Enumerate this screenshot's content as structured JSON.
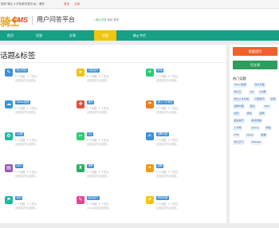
{
  "topbar": {
    "welcome": "您好 骑士人才系统问答平台！请先",
    "login": "登录",
    "register": "注册"
  },
  "header": {
    "logo_main": "骑士",
    "logo_cms": "CMS",
    "title": "用户问答平台",
    "subtitle_dot": "•",
    "subtitle_brand": "骑士问答",
    "subtitle_rest": "首页 发布"
  },
  "nav": {
    "items": [
      "首页",
      "问答",
      "文章",
      "话题",
      "骑士专栏"
    ],
    "active_index": 3
  },
  "main": {
    "title": "话题&标签",
    "cards": [
      {
        "icon": "✎",
        "color": "#3b8fd8",
        "tag": "骑士问答",
        "meta": "0 个问题 · 0 个关注",
        "desc": "话题描述信息模板..."
      },
      {
        "icon": "➤",
        "color": "#f1c40f",
        "tag": "问答技巧",
        "meta": "0 个问题 · 0 个关注",
        "desc": "话题描述信息模板..."
      },
      {
        "icon": "✈",
        "color": "#2ecc71",
        "tag": "职场",
        "meta": "0 个问题 · 0 个关注",
        "desc": "话题描述信息模板..."
      },
      {
        "icon": "☁",
        "color": "#3498db",
        "tag": "76cms官网",
        "meta": "0 个问题 · 0 个关注",
        "desc": "话题描述信息模板..."
      },
      {
        "icon": "✚",
        "color": "#e74c3c",
        "tag": "猎头",
        "meta": "0 个问题 · 0 个关注",
        "desc": "话题描述信息模板..."
      },
      {
        "icon": "☂",
        "color": "#e67e22",
        "tag": "骑士人才系统",
        "meta": "0 个问题 · 0 个关注",
        "desc": "话题描述信息模板..."
      },
      {
        "icon": "❂",
        "color": "#1abc9c",
        "tag": "QQ群",
        "meta": "0 个问题 · 0 个关注",
        "desc": "话题描述信息模板..."
      },
      {
        "icon": "✂",
        "color": "#2ecc71",
        "tag": "QQ",
        "meta": "0 个问题 · 0 个关注",
        "desc": "话题描述信息模板..."
      },
      {
        "icon": "✍",
        "color": "#3b8fd8",
        "tag": "招聘问题",
        "meta": "0 个问题 · 0 个关注",
        "desc": "话题描述信息模板..."
      },
      {
        "icon": "▤",
        "color": "#9b59b6",
        "tag": "SEO",
        "meta": "0 个问题 · 0 个关注",
        "desc": "话题描述信息模板..."
      },
      {
        "icon": "♜",
        "color": "#27ae60",
        "tag": "求职",
        "meta": "0 个问题 · 0 个关注",
        "desc": "话题描述信息模板..."
      },
      {
        "icon": "✦",
        "color": "#f39c12",
        "tag": "招聘",
        "meta": "0 个问题 · 0 个关注",
        "desc": "话题描述信息模板..."
      },
      {
        "icon": "⚑",
        "color": "#1abc9c",
        "tag": "简历",
        "meta": "0 个问题 · 0 个关注",
        "desc": "话题描述信息模板..."
      },
      {
        "icon": "✎",
        "color": "#e84393",
        "tag": "面试技巧",
        "meta": "0 个问题 · 0 个关注",
        "desc": "mysql话题描述模板..."
      },
      {
        "icon": "✐",
        "color": "#f1c40f",
        "tag": "薪资待遇",
        "meta": "0 个问题 · 0 个关注",
        "desc": "话题描述信息模板..."
      }
    ]
  },
  "sidebar": {
    "ask_button": "我要提问",
    "article_button": "写文章",
    "hot_title": "热门话题",
    "tags": [
      "76cms官网",
      "骑士问答",
      "骑士云",
      "QQ",
      "QQ群",
      "骑士人才系统",
      "问答技巧",
      "职场",
      "招聘问题",
      "猎头",
      "SEO",
      "简历",
      "求职",
      "招聘",
      "面试技巧",
      "薪资待遇",
      "人才网",
      "jQuery",
      "网站",
      "PHP",
      "Mysql",
      "前端",
      "骑士天下",
      "WebApp"
    ]
  }
}
